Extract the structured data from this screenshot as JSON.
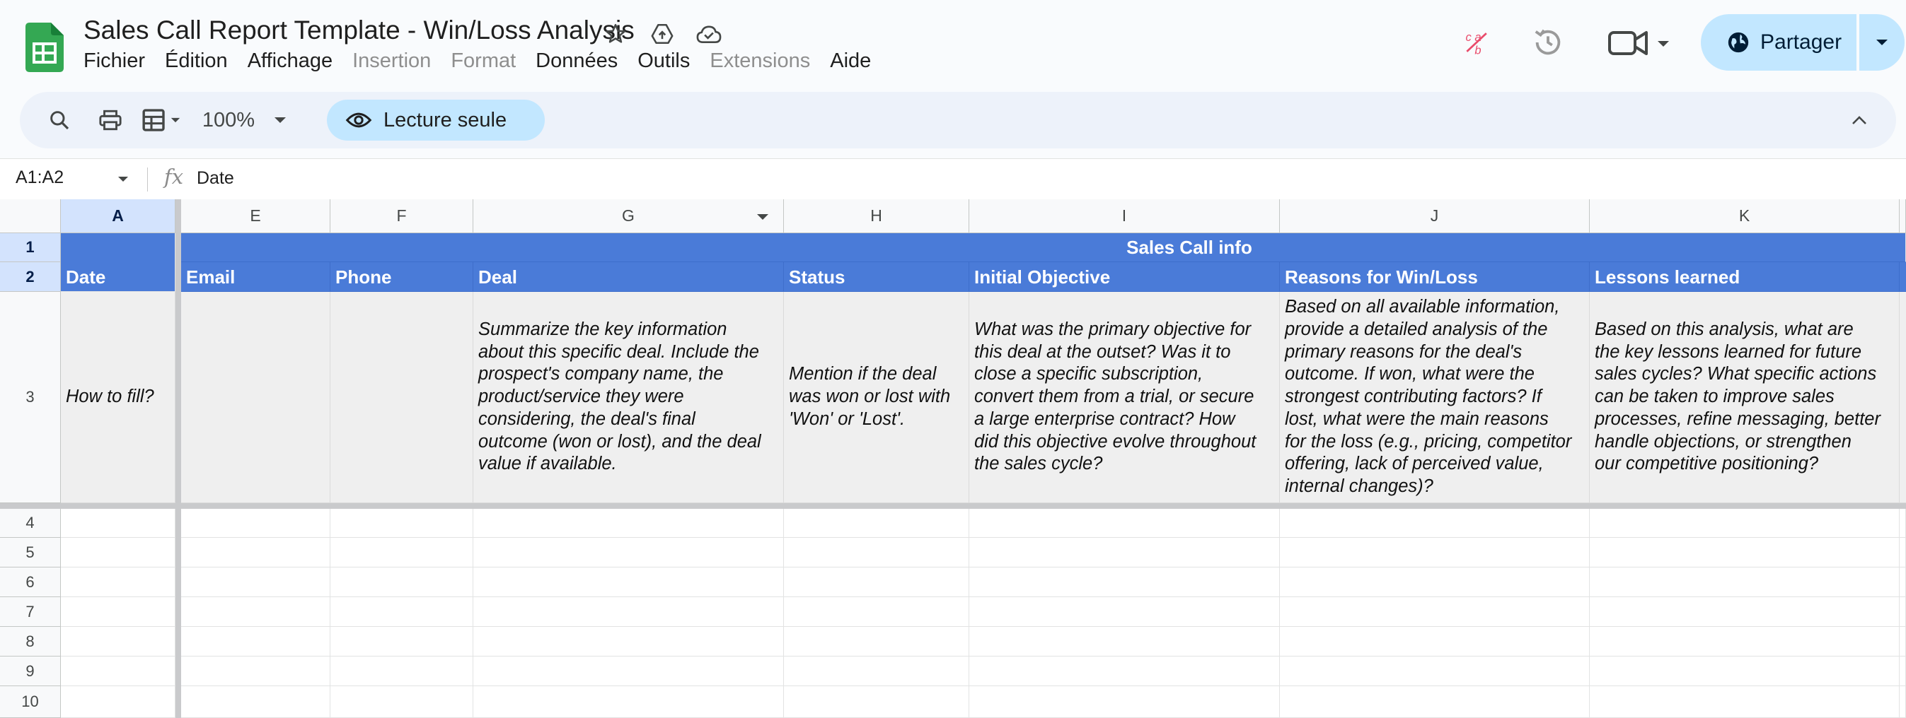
{
  "doc": {
    "title": "Sales Call Report Template - Win/Loss Analysis"
  },
  "menu": [
    {
      "label": "Fichier",
      "disabled": false
    },
    {
      "label": "Édition",
      "disabled": false
    },
    {
      "label": "Affichage",
      "disabled": false
    },
    {
      "label": "Insertion",
      "disabled": true
    },
    {
      "label": "Format",
      "disabled": true
    },
    {
      "label": "Données",
      "disabled": false
    },
    {
      "label": "Outils",
      "disabled": false
    },
    {
      "label": "Extensions",
      "disabled": true
    },
    {
      "label": "Aide",
      "disabled": false
    }
  ],
  "share": {
    "label": "Partager"
  },
  "toolbar": {
    "zoom": "100%",
    "readonly_label": "Lecture seule"
  },
  "formula": {
    "name_box": "A1:A2",
    "fx": "fx",
    "content": "Date"
  },
  "columns": [
    "A",
    "E",
    "F",
    "G",
    "H",
    "I",
    "J",
    "K"
  ],
  "rows": [
    "1",
    "2",
    "3",
    "4",
    "5",
    "6",
    "7",
    "8",
    "9",
    "10"
  ],
  "sheet": {
    "group_header": "Sales Call info",
    "headers": {
      "date": "Date",
      "email": "Email",
      "phone": "Phone",
      "deal": "Deal",
      "status": "Status",
      "objective": "Initial Objective",
      "reasons": "Reasons for Win/Loss",
      "lessons": "Lessons learned"
    },
    "how_to": {
      "label": "How to fill?",
      "deal": [
        "Summarize the key information",
        "about this specific deal. Include the",
        "prospect's company name, the",
        "product/service they were",
        "considering, the deal's final",
        "outcome (won or lost), and the deal",
        "value if available."
      ],
      "status": [
        "Mention if the deal",
        "was won or lost with",
        "'Won' or 'Lost'."
      ],
      "objective": [
        "What was the primary objective for",
        "this deal at the outset? Was it to",
        "close a specific subscription,",
        "convert them from a trial, or secure",
        "a large enterprise contract? How",
        "did this objective evolve throughout",
        "the sales cycle?"
      ],
      "reasons": [
        "Based on all available information,",
        "provide a detailed analysis of the",
        "primary reasons for the deal's",
        "outcome. If won, what were the",
        "strongest contributing factors? If",
        "lost, what were the main reasons",
        "for the loss (e.g., pricing, competitor",
        "offering, lack of perceived value,",
        "internal changes)?"
      ],
      "lessons": [
        "Based on this analysis, what are",
        "the key lessons learned for future",
        "sales cycles? What specific actions",
        "can be taken to improve sales",
        "processes, refine messaging, better",
        "handle objections, or strengthen",
        "our competitive positioning?"
      ]
    }
  },
  "colors": {
    "header_blue": "#4a7bd8",
    "share_bg": "#c2e7ff",
    "toolbar_bg": "#edf2fa",
    "selection": "#d3e3fd"
  }
}
